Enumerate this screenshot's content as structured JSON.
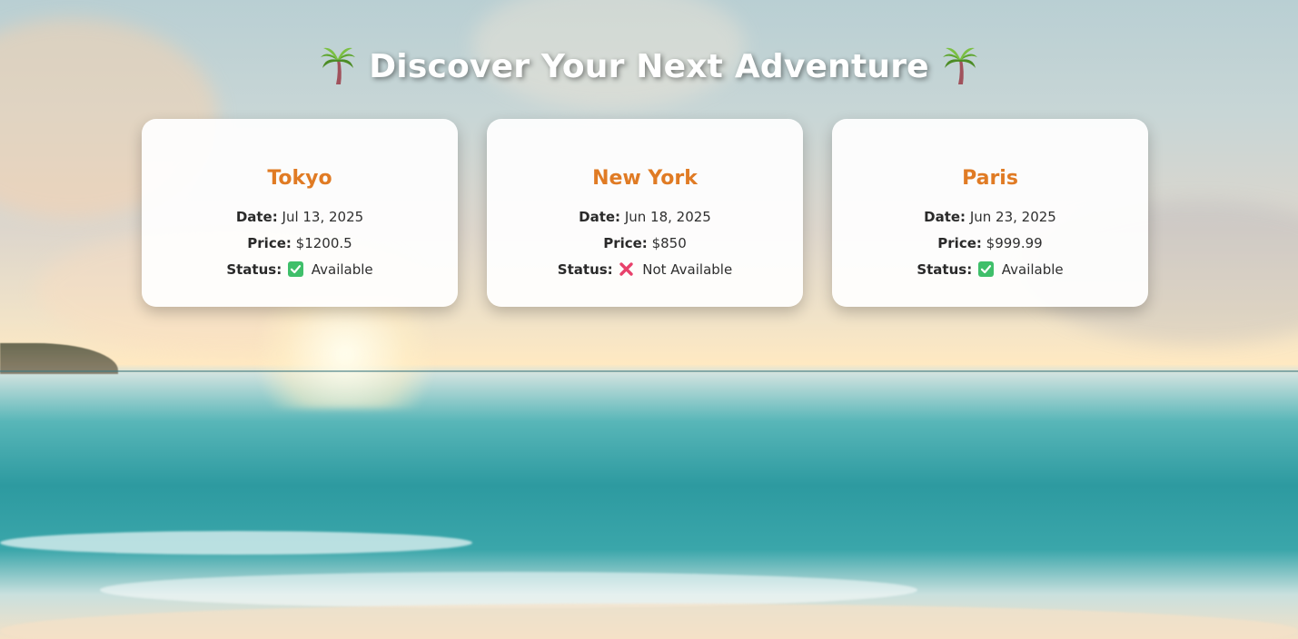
{
  "page": {
    "title": "Discover Your Next Adventure",
    "title_icon": "palm-tree-icon"
  },
  "labels": {
    "date": "Date:",
    "price": "Price:",
    "status": "Status:"
  },
  "destinations": [
    {
      "city": "Tokyo",
      "date": "Jul 13, 2025",
      "price": "$1200.5",
      "status": "Available",
      "status_icon": "check-mark-icon"
    },
    {
      "city": "New York",
      "date": "Jun 18, 2025",
      "price": "$850",
      "status": "Not Available",
      "status_icon": "cross-mark-icon"
    },
    {
      "city": "Paris",
      "date": "Jun 23, 2025",
      "price": "$999.99",
      "status": "Available",
      "status_icon": "check-mark-icon"
    }
  ],
  "colors": {
    "city_heading": "#e07b24",
    "available_icon": "#3fbf6a",
    "not_available_icon": "#e8416b"
  }
}
